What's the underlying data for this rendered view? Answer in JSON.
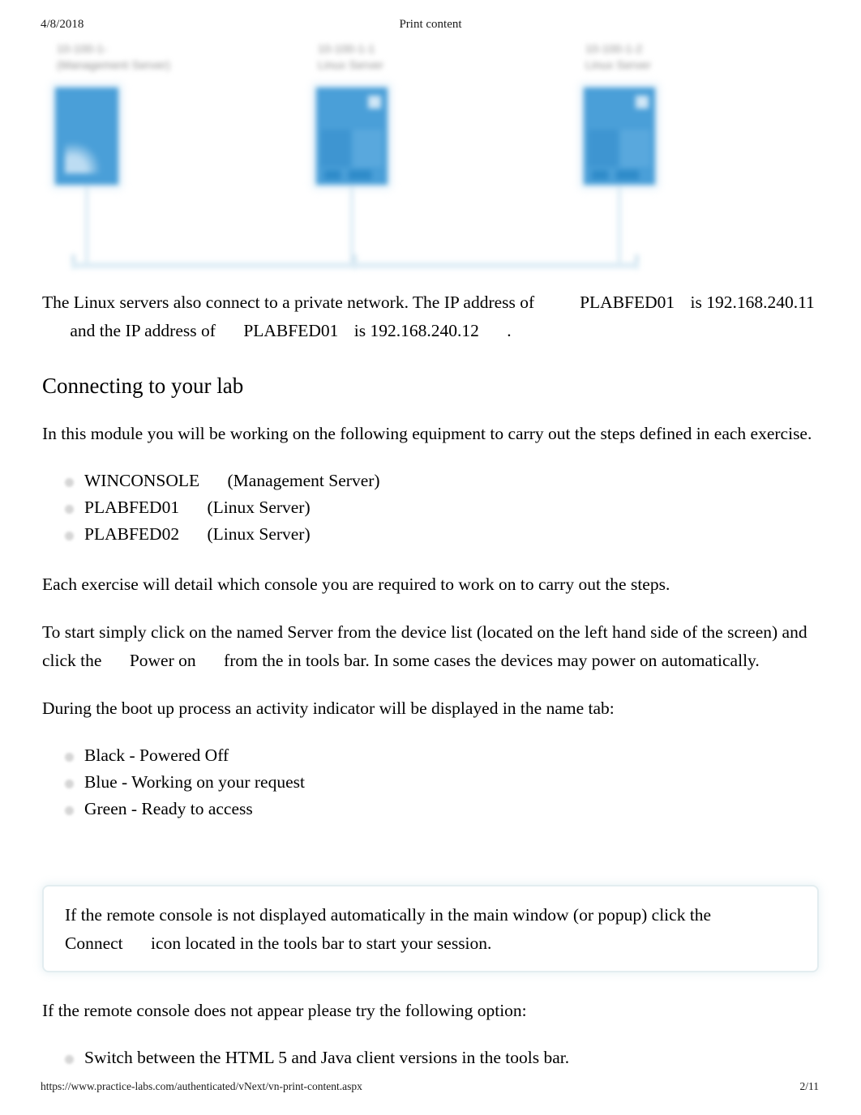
{
  "print_header": {
    "date": "4/8/2018",
    "title": "Print content"
  },
  "diagram": {
    "alt": "blurred network topology diagram of three servers on a shared bus",
    "accent_color": "#4a9fd8",
    "line_color": "#dcecf5",
    "nodes": [
      {
        "name_line1": "10-100-1-",
        "name_line2": "(Management Server)"
      },
      {
        "name_line1": "10-100-1-1",
        "name_line2": "Linux Server"
      },
      {
        "name_line1": "10-100-1-2",
        "name_line2": "Linux Server"
      }
    ]
  },
  "content": {
    "intro_paragraph": {
      "part1": "The Linux servers also connect to a private network. The IP address of",
      "host1": "PLABFED01",
      "part2": "is",
      "ip1": "192.168.240.11",
      "part3": "and the IP address of",
      "host2": "PLABFED01",
      "part4": "is",
      "ip2": "192.168.240.12",
      "part5": "."
    },
    "section_heading": "Connecting to your lab",
    "module_paragraph": "In this module you will be working on the following equipment to carry out the steps defined in each exercise.",
    "equipment_list": [
      {
        "name": "WINCONSOLE",
        "role": "(Management Server)"
      },
      {
        "name": "PLABFED01",
        "role": "(Linux Server)"
      },
      {
        "name": "PLABFED02",
        "role": "(Linux Server)"
      }
    ],
    "each_exercise_paragraph": "Each exercise will detail which console you are required to work on to carry out the steps.",
    "start_paragraph": {
      "part1": "To start simply click on the named Server from the device list (located on the left hand side of the screen) and click the",
      "action": "Power on",
      "part2": "from the in tools bar. In some cases the devices may power on automatically."
    },
    "boot_paragraph": "During the boot up process an activity indicator will be displayed in the name tab:",
    "indicator_list": [
      "Black - Powered Off",
      "Blue - Working on your request",
      "Green - Ready to access"
    ],
    "callout": {
      "part1": "If the remote console is not displayed automatically in the main window (or popup) click the",
      "action": "Connect",
      "part2": "icon located in the tools bar to start your session."
    },
    "fallback_paragraph": "If the remote console does not appear please try the following option:",
    "fallback_list": [
      "Switch between the HTML 5 and Java client versions in the tools bar."
    ]
  },
  "print_footer": {
    "url": "https://www.practice-labs.com/authenticated/vNext/vn-print-content.aspx",
    "page": "2/11"
  }
}
